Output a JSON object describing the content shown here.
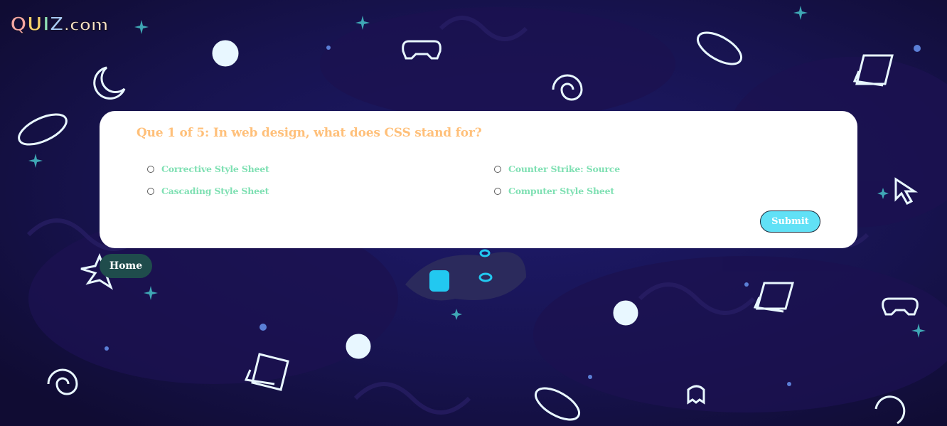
{
  "logo": {
    "q": "Q",
    "u": "U",
    "i": "I",
    "z": "Z",
    "dotcom": ".com"
  },
  "quiz": {
    "question": "Que 1 of 5: In web design, what does CSS stand for?",
    "options": [
      {
        "label": "Corrective Style Sheet"
      },
      {
        "label": "Counter Strike: Source"
      },
      {
        "label": "Cascading Style Sheet"
      },
      {
        "label": "Computer Style Sheet"
      }
    ],
    "submit_label": "Submit"
  },
  "nav": {
    "home_label": "Home"
  },
  "colors": {
    "background": "#17124f",
    "question_text": "#ffc07a",
    "option_text": "#7fe0b3",
    "submit_bg": "#61e1f6",
    "home_bg": "#1f4c4c"
  }
}
